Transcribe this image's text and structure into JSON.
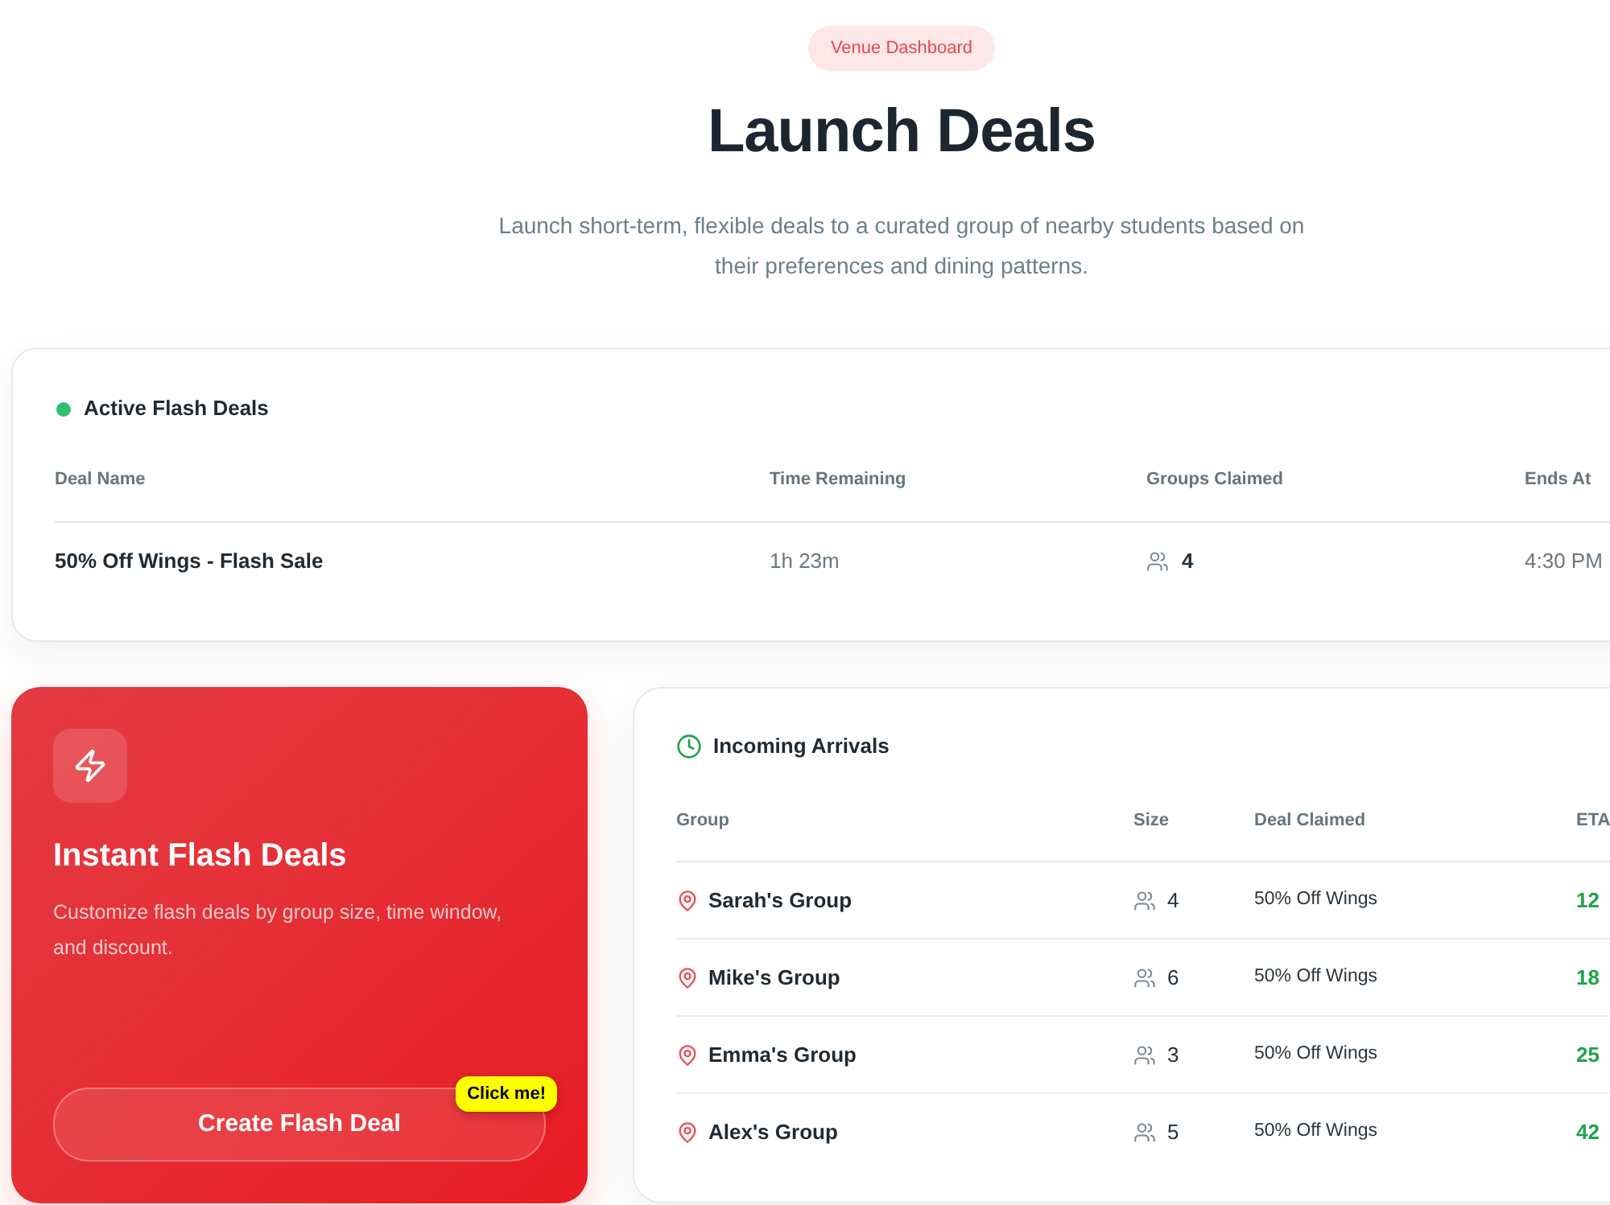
{
  "header": {
    "badge": "Venue Dashboard",
    "title": "Launch Deals",
    "subtitle": "Launch short-term, flexible deals to a curated group of nearby students based on their preferences and dining patterns."
  },
  "active_deals": {
    "title": "Active Flash Deals",
    "columns": [
      "Deal Name",
      "Time Remaining",
      "Groups Claimed",
      "Ends At"
    ],
    "rows": [
      {
        "deal_name": "50% Off Wings - Flash Sale",
        "time_remaining": "1h 23m",
        "groups_claimed": "4",
        "ends_at": "4:30 PM"
      }
    ]
  },
  "promo_card": {
    "title": "Instant Flash Deals",
    "description": "Customize flash deals by group size, time window, and discount.",
    "button": "Create Flash Deal",
    "callout": "Click me!"
  },
  "arrivals": {
    "title": "Incoming Arrivals",
    "columns": [
      "Group",
      "Size",
      "Deal Claimed",
      "ETA"
    ],
    "rows": [
      {
        "group": "Sarah's Group",
        "size": "4",
        "deal_claimed": "50% Off Wings",
        "eta": "12"
      },
      {
        "group": "Mike's Group",
        "size": "6",
        "deal_claimed": "50% Off Wings",
        "eta": "18"
      },
      {
        "group": "Emma's Group",
        "size": "3",
        "deal_claimed": "50% Off Wings",
        "eta": "25"
      },
      {
        "group": "Alex's Group",
        "size": "5",
        "deal_claimed": "50% Off Wings",
        "eta": "42"
      }
    ]
  }
}
